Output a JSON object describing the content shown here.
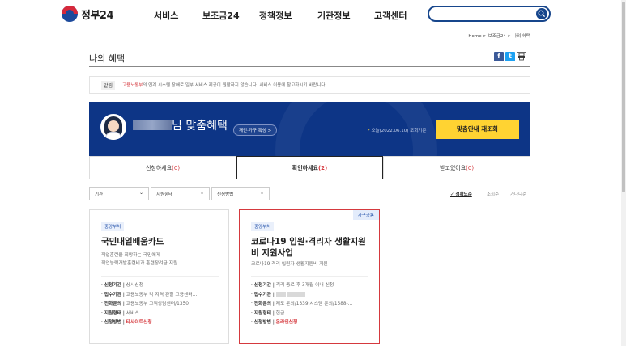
{
  "header": {
    "logo_text": "정부24",
    "nav": [
      "서비스",
      "보조금24",
      "정책정보",
      "기관정보",
      "고객센터"
    ],
    "search_placeholder": ""
  },
  "breadcrumb": "Home > 보조금24 > 나의 혜택",
  "page_title": "나의 혜택",
  "notice": {
    "tag": "알림",
    "highlight": "고용노동부",
    "message": "의 연계 시스템 장애로 일부 서비스 제공이 원활하지 않습니다. 서비스 이용에 참고하시기 바랍니다."
  },
  "banner": {
    "name_suffix": "님 맞춤혜택",
    "household_pill": "개인·가구 특성 >",
    "date_star": "*",
    "date_text": "오늘(2022.06.10) 조회기준",
    "refresh_button": "맞춤안내 재조회"
  },
  "tabs": [
    {
      "label": "신청하세요",
      "count": "(0)"
    },
    {
      "label": "확인하세요",
      "count": "(2)"
    },
    {
      "label": "받고있어요",
      "count": "(0)"
    }
  ],
  "filters": [
    "기관",
    "지원형태",
    "신청방법"
  ],
  "sort_options": [
    "정확도순",
    "조회순",
    "가나다순"
  ],
  "cards": [
    {
      "badge": "중앙부처",
      "corner": "",
      "title": "국민내일배움카드",
      "desc1": "직업훈련을 희망하는 국민에게",
      "desc2": "직업능력개발훈련비과 훈련장려금 지원",
      "rows": [
        {
          "k": "신청기간",
          "v": "상시신청"
        },
        {
          "k": "접수기관",
          "v": "고용노동부 각 지역 관할 고용센터..."
        },
        {
          "k": "전화문의",
          "v": "고용노동부 고객상담센터/1350"
        },
        {
          "k": "지원형태",
          "v": "서비스"
        },
        {
          "k": "신청방법",
          "v": "타사이트신청"
        }
      ]
    },
    {
      "badge": "중앙부처",
      "corner": "가구공통",
      "title1": "코로나19 입원·격리자 생활지원",
      "title2": "비 지원사업",
      "desc1": "코로나19 격리 입원자 생활지원비 지원",
      "rows": [
        {
          "k": "신청기간",
          "v": "격리 종료 후 3개월 이내 신청"
        },
        {
          "k": "접수기관",
          "v": ""
        },
        {
          "k": "전화문의",
          "v": "제도 문의/1339,시스템 문의/1588-..."
        },
        {
          "k": "지원형태",
          "v": "현금"
        },
        {
          "k": "신청방법",
          "v": "온라인신청"
        }
      ]
    }
  ]
}
